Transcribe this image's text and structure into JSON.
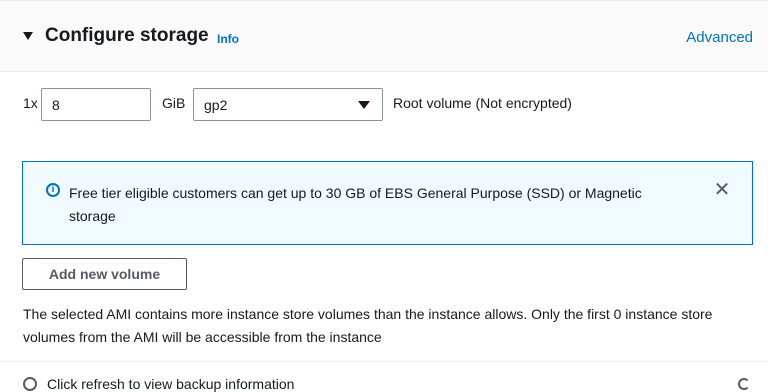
{
  "section": {
    "title": "Configure storage",
    "info_link": "Info",
    "advanced_link": "Advanced"
  },
  "volume": {
    "quantity": "1x",
    "size_value": "8",
    "unit": "GiB",
    "volume_type": "gp2",
    "root_label": "Root volume  (Not encrypted)"
  },
  "alert": {
    "message": "Free tier eligible customers can get up to 30 GB of EBS General Purpose (SSD) or Magnetic storage",
    "icon": "info-icon",
    "close_icon": "close-icon"
  },
  "buttons": {
    "add_volume": "Add new volume"
  },
  "note": "The selected AMI contains more instance store volumes than the instance allows. Only the first 0 instance store volumes from the AMI will be accessible from the instance",
  "backup": {
    "message": "Click refresh to view backup information"
  },
  "colors": {
    "link": "#0073bb",
    "alert_border": "#0073bb",
    "alert_bg": "#f1faff"
  }
}
